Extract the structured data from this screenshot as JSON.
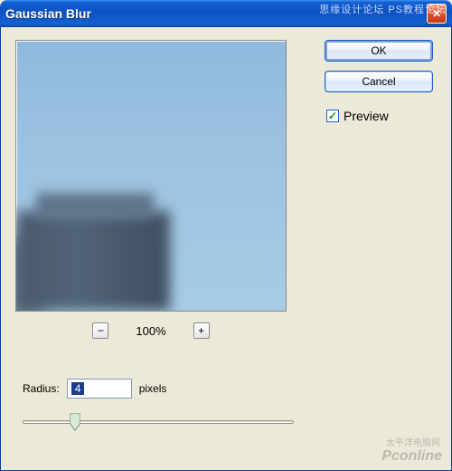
{
  "title": "Gaussian Blur",
  "close_glyph": "✕",
  "buttons": {
    "ok": "OK",
    "cancel": "Cancel"
  },
  "preview": {
    "checkbox_label": "Preview",
    "checked_glyph": "✓"
  },
  "zoom": {
    "minus": "−",
    "plus": "+",
    "percent": "100%"
  },
  "radius": {
    "label": "Radius:",
    "value": "4",
    "unit": "pixels"
  },
  "watermark": {
    "top": "思缘设计论坛  PS教程论坛",
    "bottom_small": "太平洋电脑网",
    "bottom": "Pconline"
  }
}
